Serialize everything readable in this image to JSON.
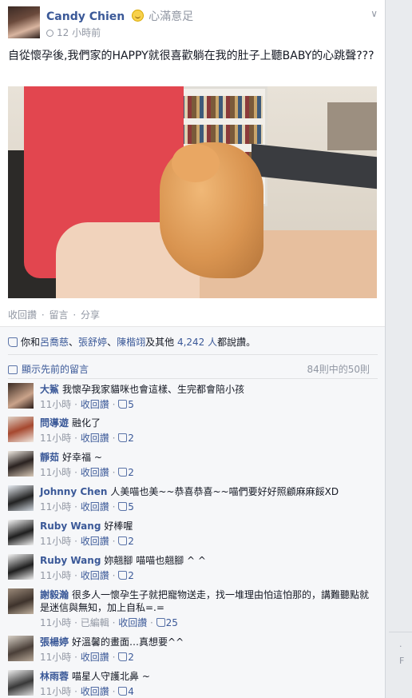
{
  "post": {
    "author": "Candy Chien",
    "feeling": "心滿意足",
    "timestamp": "12 小時前",
    "text": "自從懷孕後,我們家的HAPPY就很喜歡躺在我的肚子上聽BABY的心跳聲???",
    "actions": [
      "收回讚",
      "留言",
      "分享"
    ],
    "action_sep": "·"
  },
  "likes": {
    "prefix": "你和",
    "names": [
      "呂喬慈",
      "張舒婷",
      "陳楷翊"
    ],
    "joiner": "、",
    "conj": "及其他",
    "count": "4,242 人",
    "suffix": "都說讚。"
  },
  "comments_header": {
    "prev_label": "顯示先前的留言",
    "count": "84則中的50則"
  },
  "comments": [
    {
      "name": "大鯊",
      "text": "我懷孕我家貓咪也會這樣、生完都會陪小孩",
      "time": "11小時",
      "action": "收回讚",
      "edited": "",
      "likes": "5"
    },
    {
      "name": "問導遊",
      "text": "融化了",
      "time": "11小時",
      "action": "收回讚",
      "edited": "",
      "likes": "2"
    },
    {
      "name": "靜茹",
      "text": "好幸福 ~",
      "time": "11小時",
      "action": "收回讚",
      "edited": "",
      "likes": "2"
    },
    {
      "name": "Johnny Chen",
      "text": "人美喵也美~~恭喜恭喜~~喵們要好好照顧麻麻餒XD",
      "time": "11小時",
      "action": "收回讚",
      "edited": "",
      "likes": "5"
    },
    {
      "name": "Ruby Wang",
      "text": "好棒喔",
      "time": "11小時",
      "action": "收回讚",
      "edited": "",
      "likes": "2"
    },
    {
      "name": "Ruby Wang",
      "text": "妳翹腳 喵喵也翹腳 ^ ^",
      "time": "11小時",
      "action": "收回讚",
      "edited": "",
      "likes": "2"
    },
    {
      "name": "謝毅瀚",
      "text": "很多人一懷孕生子就把寵物送走，找一堆理由怕這怕那的，講難聽點就是迷信與無知，加上自私=.=",
      "time": "11小時",
      "action": "收回讚",
      "edited": "已編輯",
      "likes": "25"
    },
    {
      "name": "張楊婷",
      "text": "好溫馨的畫面…真想要^^",
      "time": "11小時",
      "action": "收回讚",
      "edited": "",
      "likes": "2"
    },
    {
      "name": "林雨蓉",
      "text": "喵星人守護北鼻 ~",
      "time": "11小時",
      "action": "收回讚",
      "edited": "",
      "likes": "4"
    }
  ],
  "sidebar_fragment": {
    "line1": "·",
    "line2": "F"
  },
  "colors": {
    "link": "#3b5998",
    "meta": "#9197a3",
    "ufi_bg": "#f6f7f9"
  }
}
